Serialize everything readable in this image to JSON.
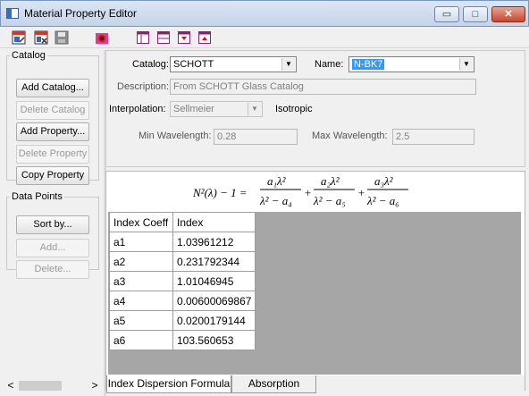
{
  "window": {
    "title": "Material Property Editor",
    "minimize": "▭",
    "maximize": "□",
    "close": "✕"
  },
  "toolbar": {
    "icons": [
      "open-catalog-icon",
      "save-as-icon",
      "save-icon",
      "bug-icon",
      "window-layout-icon",
      "split-horizontal-icon",
      "collapse-icon",
      "expand-icon"
    ]
  },
  "left": {
    "catalog_legend": "Catalog",
    "add_catalog": "Add Catalog...",
    "delete_catalog": "Delete Catalog",
    "add_property": "Add  Property...",
    "delete_property": "Delete Property",
    "copy_property": "Copy Property",
    "datapoints_legend": "Data Points",
    "sort_by": "Sort by...",
    "add": "Add...",
    "delete": "Delete...",
    "scroll_left": "<",
    "scroll_right": ">"
  },
  "props": {
    "catalog_label": "Catalog:",
    "catalog_value": "SCHOTT",
    "name_label": "Name:",
    "name_value": "N-BK7",
    "description_label": "Description:",
    "description_value": "From SCHOTT Glass Catalog",
    "interpolation_label": "Interpolation:",
    "interpolation_value": "Sellmeier",
    "isotropic": "Isotropic",
    "min_label": "Min Wavelength:",
    "min_value": "0.28",
    "max_label": "Max Wavelength:",
    "max_value": "2.5"
  },
  "formula": {
    "lhs": "N²(λ) − 1 =",
    "term1_num": "a₁λ²",
    "term1_den": "λ² − a₄",
    "term2_num": "a₂λ²",
    "term2_den": "λ² − a₅",
    "term3_num": "a₃λ²",
    "term3_den": "λ² − a₆",
    "plus": "+"
  },
  "grid": {
    "headers": [
      "Index Coeff",
      "Index"
    ],
    "rows": [
      [
        "a1",
        "1.03961212"
      ],
      [
        "a2",
        "0.231792344"
      ],
      [
        "a3",
        "1.01046945"
      ],
      [
        "a4",
        "0.00600069867"
      ],
      [
        "a5",
        "0.0200179144"
      ],
      [
        "a6",
        "103.560653"
      ]
    ]
  },
  "tabs": [
    "Index Dispersion Formula",
    "Absorption"
  ]
}
